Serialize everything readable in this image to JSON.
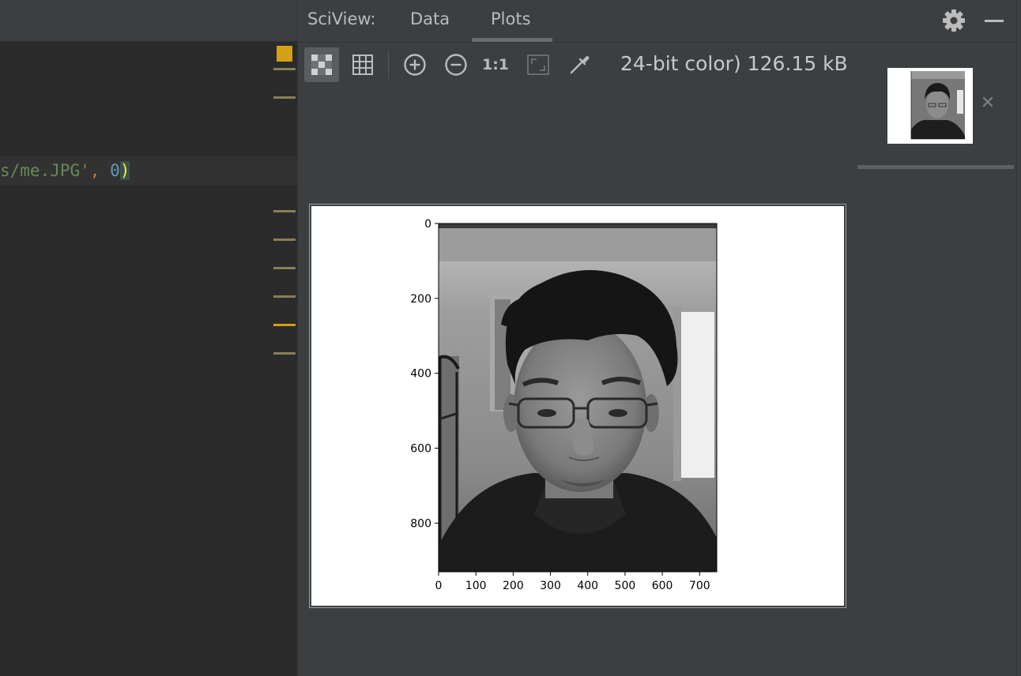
{
  "editor": {
    "code_segments": {
      "string": "s/me.JPG'",
      "comma": ",",
      "number": "0",
      "paren": ")"
    }
  },
  "sciview": {
    "title": "SciView:",
    "tabs": [
      {
        "label": "Data",
        "selected": false
      },
      {
        "label": "Plots",
        "selected": true
      }
    ],
    "icons": {
      "settings": "gear-icon",
      "minimize": "minimize-icon",
      "close_thumbnail": "close-icon"
    },
    "toolbar": {
      "one_to_one_label": "1:1",
      "buttons": [
        {
          "name": "show-transparency-chessboard",
          "icon": "chessboard-icon",
          "selected": true
        },
        {
          "name": "show-grid",
          "icon": "grid-icon",
          "selected": false
        },
        {
          "name": "zoom-in",
          "icon": "zoom-in-icon",
          "selected": false
        },
        {
          "name": "zoom-out",
          "icon": "zoom-out-icon",
          "selected": false
        },
        {
          "name": "actual-size",
          "icon": "one-to-one-icon",
          "selected": false
        },
        {
          "name": "fit-zoom",
          "icon": "fit-zoom-icon",
          "selected": false
        },
        {
          "name": "color-picker",
          "icon": "eyedropper-icon",
          "selected": false
        }
      ],
      "info_text": "24-bit color) 126.15 kB"
    },
    "close_symbol": "✕"
  },
  "chart_data": {
    "type": "image",
    "title": "",
    "xlabel": "",
    "ylabel": "",
    "xlim": [
      0,
      746
    ],
    "ylim": [
      930,
      0
    ],
    "x_ticks": [
      "0",
      "100",
      "200",
      "300",
      "400",
      "500",
      "600",
      "700"
    ],
    "y_ticks": [
      "0",
      "200",
      "400",
      "600",
      "800"
    ],
    "x_tick_values": [
      0,
      100,
      200,
      300,
      400,
      500,
      600,
      700
    ],
    "y_tick_values": [
      0,
      200,
      400,
      600,
      800
    ],
    "colormap": "gray",
    "content": "grayscale portrait photo"
  },
  "colors": {
    "editor_bg": "#2b2b2b",
    "panel_bg": "#3c3f41",
    "accent_marker": "#d4a017",
    "text": "#bbbbbb"
  }
}
